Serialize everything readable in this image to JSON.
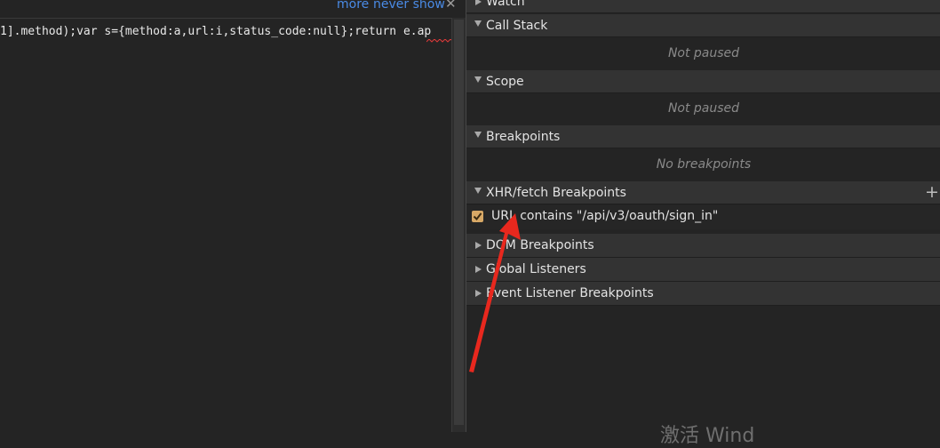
{
  "infobar": {
    "more_label": "more",
    "never_show_label": "never show",
    "close_glyph": "✕"
  },
  "code": {
    "line": "1].method);var s={method:a,url:i,status_code:null};return e.ap"
  },
  "debugger": {
    "watch": {
      "title": "Watch"
    },
    "call_stack": {
      "title": "Call Stack",
      "placeholder": "Not paused"
    },
    "scope": {
      "title": "Scope",
      "placeholder": "Not paused"
    },
    "breakpoints": {
      "title": "Breakpoints",
      "placeholder": "No breakpoints"
    },
    "xhr": {
      "title": "XHR/fetch Breakpoints",
      "add_glyph": "+",
      "entry": {
        "checked": true,
        "label": "URL contains \"/api/v3/oauth/sign_in\""
      }
    },
    "dom": {
      "title": "DOM Breakpoints"
    },
    "global": {
      "title": "Global Listeners"
    },
    "event": {
      "title": "Event Listener Breakpoints"
    }
  },
  "watermark": {
    "text": "激活 Wind"
  },
  "colors": {
    "background": "#242424",
    "section_header": "#333333",
    "link": "#4a8be6",
    "checkbox": "#d7a866",
    "annotation_arrow": "#e8281e"
  },
  "icons": [
    "close-icon",
    "expand-triangle-icon",
    "collapse-triangle-icon",
    "add-icon",
    "checkbox-check-icon"
  ]
}
